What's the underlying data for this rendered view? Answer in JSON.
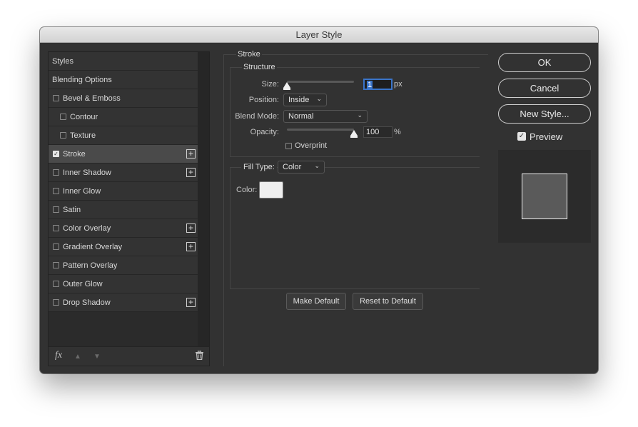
{
  "window": {
    "title": "Layer Style"
  },
  "styles_panel": {
    "items": [
      {
        "label": "Styles",
        "checkbox": false,
        "checked": false,
        "plus": false,
        "indent": false,
        "header": true
      },
      {
        "label": "Blending Options",
        "checkbox": false,
        "checked": false,
        "plus": false,
        "indent": false,
        "header": true
      },
      {
        "label": "Bevel & Emboss",
        "checkbox": true,
        "checked": false,
        "plus": false,
        "indent": false
      },
      {
        "label": "Contour",
        "checkbox": true,
        "checked": false,
        "plus": false,
        "indent": true
      },
      {
        "label": "Texture",
        "checkbox": true,
        "checked": false,
        "plus": false,
        "indent": true
      },
      {
        "label": "Stroke",
        "checkbox": true,
        "checked": true,
        "plus": true,
        "indent": false,
        "selected": true
      },
      {
        "label": "Inner Shadow",
        "checkbox": true,
        "checked": false,
        "plus": true,
        "indent": false
      },
      {
        "label": "Inner Glow",
        "checkbox": true,
        "checked": false,
        "plus": false,
        "indent": false
      },
      {
        "label": "Satin",
        "checkbox": true,
        "checked": false,
        "plus": false,
        "indent": false
      },
      {
        "label": "Color Overlay",
        "checkbox": true,
        "checked": false,
        "plus": true,
        "indent": false
      },
      {
        "label": "Gradient Overlay",
        "checkbox": true,
        "checked": false,
        "plus": true,
        "indent": false
      },
      {
        "label": "Pattern Overlay",
        "checkbox": true,
        "checked": false,
        "plus": false,
        "indent": false
      },
      {
        "label": "Outer Glow",
        "checkbox": true,
        "checked": false,
        "plus": false,
        "indent": false
      },
      {
        "label": "Drop Shadow",
        "checkbox": true,
        "checked": false,
        "plus": true,
        "indent": false
      }
    ],
    "footer": {
      "fx": "fx",
      "up": "▲",
      "down": "▼",
      "trash": "🗑"
    }
  },
  "stroke": {
    "title": "Stroke",
    "structure": {
      "title": "Structure",
      "size_label": "Size:",
      "size_value": "1",
      "size_unit": "px",
      "size_slider_level": 0.0,
      "position_label": "Position:",
      "position_value": "Inside",
      "blend_mode_label": "Blend Mode:",
      "blend_mode_value": "Normal",
      "opacity_label": "Opacity:",
      "opacity_value": "100",
      "opacity_unit": "%",
      "opacity_slider_level": 1.0,
      "overprint_label": "Overprint",
      "overprint_checked": false
    },
    "fill": {
      "fill_type_label": "Fill Type:",
      "fill_type_value": "Color",
      "color_label": "Color:",
      "color_value": "#efefef"
    },
    "make_default": "Make Default",
    "reset_default": "Reset to Default"
  },
  "actions": {
    "ok": "OK",
    "cancel": "Cancel",
    "new_style": "New Style...",
    "preview_label": "Preview",
    "preview_checked": true
  }
}
